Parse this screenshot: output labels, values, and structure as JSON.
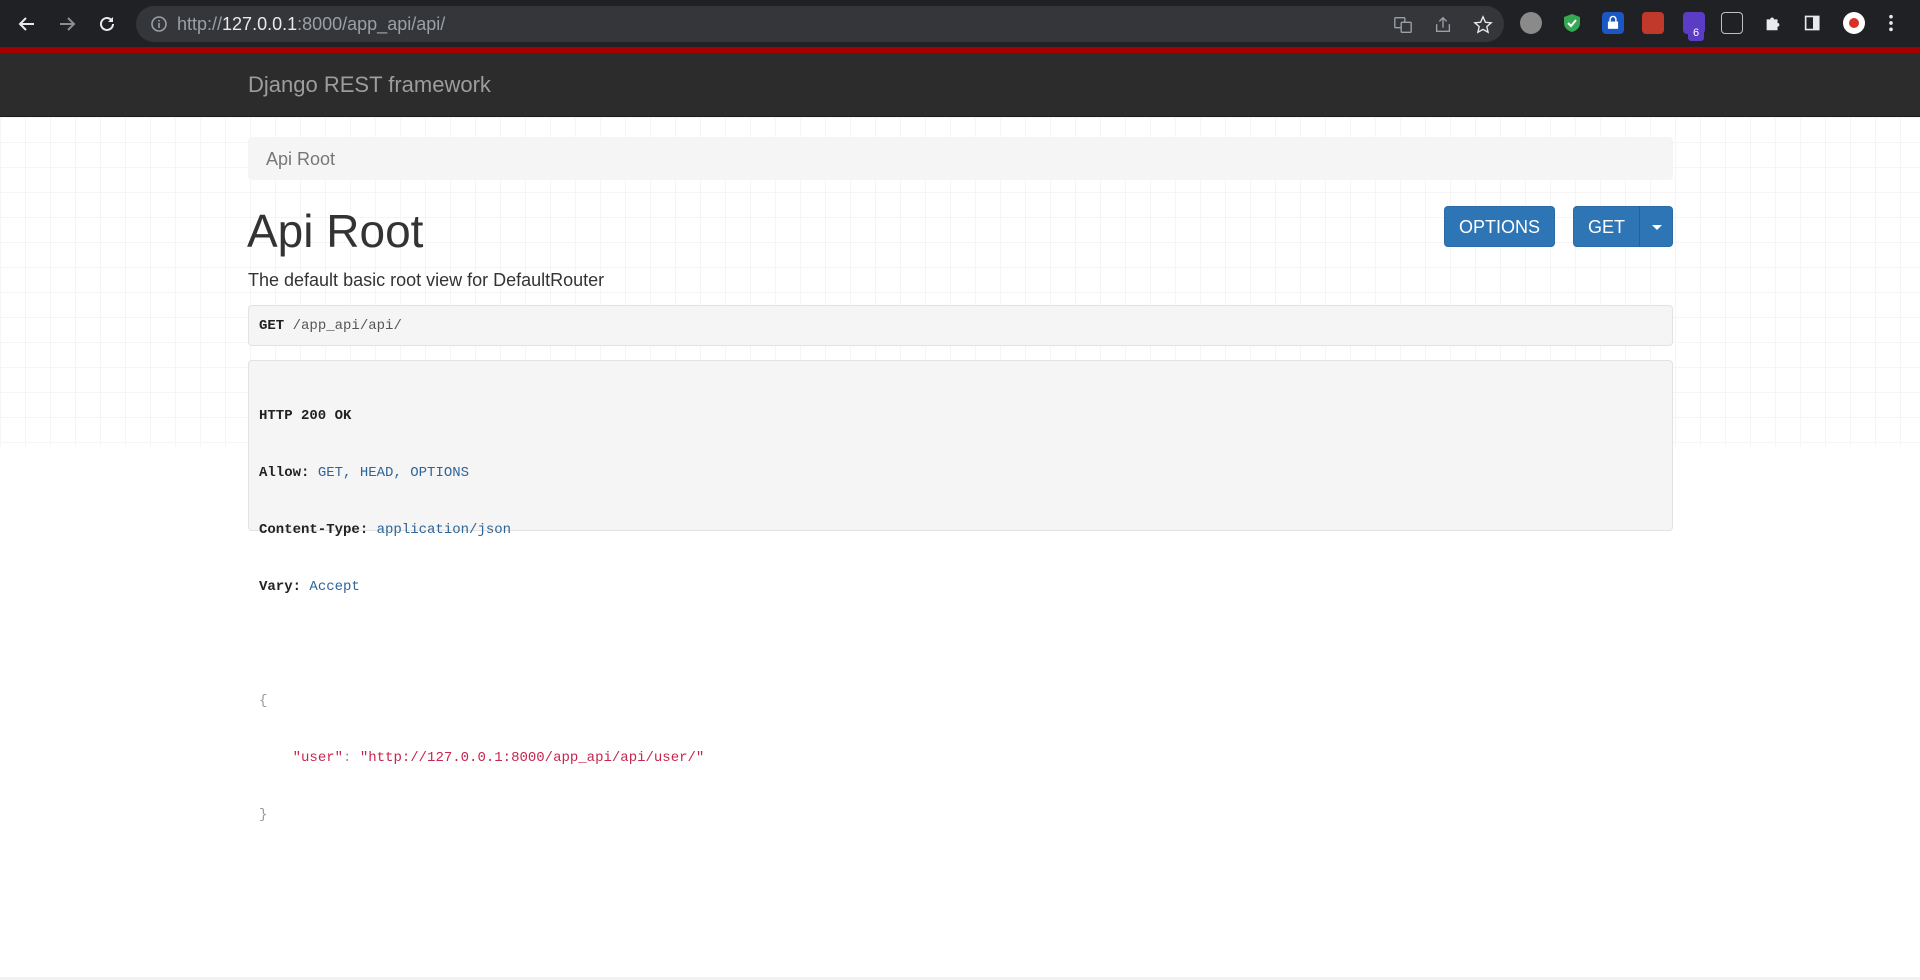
{
  "browser": {
    "url_prefix": "http://",
    "url_host": "127.0.0.1",
    "url_rest": ":8000/app_api/api/",
    "extension_badge": "6"
  },
  "navbar": {
    "brand": "Django REST framework"
  },
  "breadcrumb": {
    "current": "Api Root"
  },
  "page": {
    "title": "Api Root",
    "description": "The default basic root view for DefaultRouter"
  },
  "buttons": {
    "options": "OPTIONS",
    "get": "GET"
  },
  "request": {
    "method": "GET",
    "path": "/app_api/api/"
  },
  "response": {
    "status": "HTTP 200 OK",
    "headers": [
      {
        "name": "Allow:",
        "value": "GET, HEAD, OPTIONS"
      },
      {
        "name": "Content-Type:",
        "value": "application/json"
      },
      {
        "name": "Vary:",
        "value": "Accept"
      }
    ],
    "json_open": "{",
    "json_key": "\"user\"",
    "json_colon": ": ",
    "json_value": "\"http://127.0.0.1:8000/app_api/api/user/\"",
    "json_close": "}"
  },
  "colors": {
    "primary_button": "#2e75b6",
    "navbar": "#2c2c2c",
    "accent_strip": "#a30000"
  }
}
